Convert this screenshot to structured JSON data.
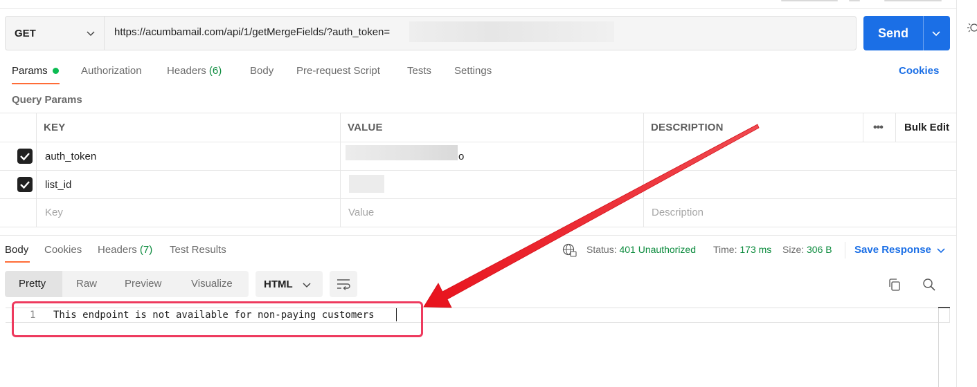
{
  "request": {
    "method": "GET",
    "url": "https://acumbamail.com/api/1/getMergeFields/?auth_token=",
    "send_label": "Send"
  },
  "request_tabs": {
    "params": "Params",
    "authorization": "Authorization",
    "headers": "Headers",
    "headers_count": "(6)",
    "body": "Body",
    "prerequest": "Pre-request Script",
    "tests": "Tests",
    "settings": "Settings",
    "cookies": "Cookies"
  },
  "query_params": {
    "title": "Query Params",
    "columns": {
      "key": "KEY",
      "value": "VALUE",
      "description": "DESCRIPTION"
    },
    "more_label": "•••",
    "bulk_edit": "Bulk Edit",
    "rows": [
      {
        "checked": true,
        "key": "auth_token",
        "value_tail": "o",
        "description": ""
      },
      {
        "checked": true,
        "key": "list_id",
        "value_tail": "",
        "description": ""
      }
    ],
    "placeholder": {
      "key": "Key",
      "value": "Value",
      "description": "Description"
    }
  },
  "response_tabs": {
    "body": "Body",
    "cookies": "Cookies",
    "headers": "Headers",
    "headers_count": "(7)",
    "test_results": "Test Results"
  },
  "response_status": {
    "status_label": "Status:",
    "status_value": "401 Unauthorized",
    "time_label": "Time:",
    "time_value": "173 ms",
    "size_label": "Size:",
    "size_value": "306 B",
    "save_response": "Save Response"
  },
  "view_modes": [
    "Pretty",
    "Raw",
    "Preview",
    "Visualize"
  ],
  "active_view": "Pretty",
  "format": "HTML",
  "editor": {
    "line_number": "1",
    "content": "This endpoint is not available for non-paying customers"
  },
  "colors": {
    "accent_blue": "#1b6fe6",
    "tab_orange": "#ff6c37",
    "status_green": "#0a8a3c",
    "annotation_red": "#ee3a5e",
    "arrow_red": "#e8131d"
  }
}
